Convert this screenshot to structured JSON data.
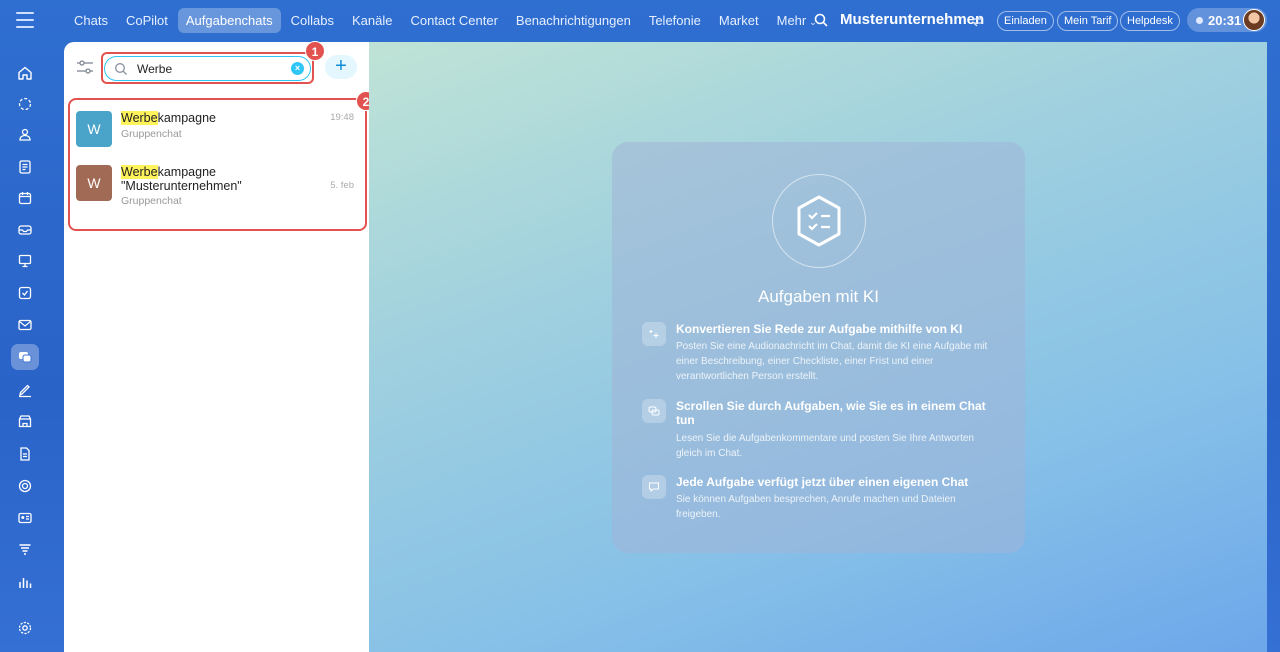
{
  "topbar": {
    "nav": [
      {
        "label": "Chats",
        "active": false
      },
      {
        "label": "CoPilot",
        "active": false
      },
      {
        "label": "Aufgabenchats",
        "active": true
      },
      {
        "label": "Collabs",
        "active": false
      },
      {
        "label": "Kanäle",
        "active": false
      },
      {
        "label": "Contact Center",
        "active": false
      },
      {
        "label": "Benachrichtigungen",
        "active": false
      },
      {
        "label": "Telefonie",
        "active": false
      },
      {
        "label": "Market",
        "active": false
      },
      {
        "label": "Mehr",
        "active": false
      }
    ],
    "company": "Musterunternehmen",
    "invite_label": "Einladen",
    "tariff_label": "Mein Tarif",
    "helpdesk_label": "Helpdesk",
    "time": "20:31"
  },
  "sidebar": {
    "icons": [
      "home-icon",
      "copilot-icon",
      "people-icon",
      "feed-icon",
      "calendar-icon",
      "inbox-icon",
      "presentation-icon",
      "tasks-icon",
      "mail-icon",
      "messenger-icon",
      "sign-icon",
      "store-icon",
      "document-icon",
      "crm-icon",
      "contact-card-icon",
      "funnel-icon",
      "analytics-icon",
      "settings-icon"
    ],
    "active": "messenger-icon"
  },
  "chat_list": {
    "search": {
      "value": "Werbe",
      "placeholder": ""
    },
    "annotations": [
      "1",
      "2"
    ],
    "items": [
      {
        "avatar_letter": "W",
        "avatar_color": "#4aa3c9",
        "title_highlight": "Werbe",
        "title_rest": "kampagne",
        "title_line2": "",
        "subtitle": "Gruppenchat",
        "time": "19:48"
      },
      {
        "avatar_letter": "W",
        "avatar_color": "#a16a55",
        "title_highlight": "Werbe",
        "title_rest": "kampagne",
        "title_line2": "\"Musterunternehmen\"",
        "subtitle": "Gruppenchat",
        "time": "5. feb"
      }
    ]
  },
  "promo": {
    "title": "Aufgaben mit KI",
    "features": [
      {
        "icon": "sparkle-icon",
        "heading": "Konvertieren Sie Rede zur Aufgabe mithilfe von KI",
        "text": "Posten Sie eine Audionachricht im Chat, damit die KI eine Aufgabe mit einer Beschreibung, einer Checkliste, einer Frist und einer verantwortlichen Person erstellt."
      },
      {
        "icon": "chat-bubbles-icon",
        "heading": "Scrollen Sie durch Aufgaben, wie Sie es in einem Chat tun",
        "text": "Lesen Sie die Aufgabenkommentare und posten Sie Ihre Antworten gleich im Chat."
      },
      {
        "icon": "message-icon",
        "heading": "Jede Aufgabe verfügt jetzt über einen eigenen Chat",
        "text": "Sie können Aufgaben besprechen, Anrufe machen und Dateien freigeben."
      }
    ]
  },
  "colors": {
    "highlight_border": "#e2534f",
    "accent": "#2fc6f6",
    "search_highlight": "#fff35c"
  }
}
